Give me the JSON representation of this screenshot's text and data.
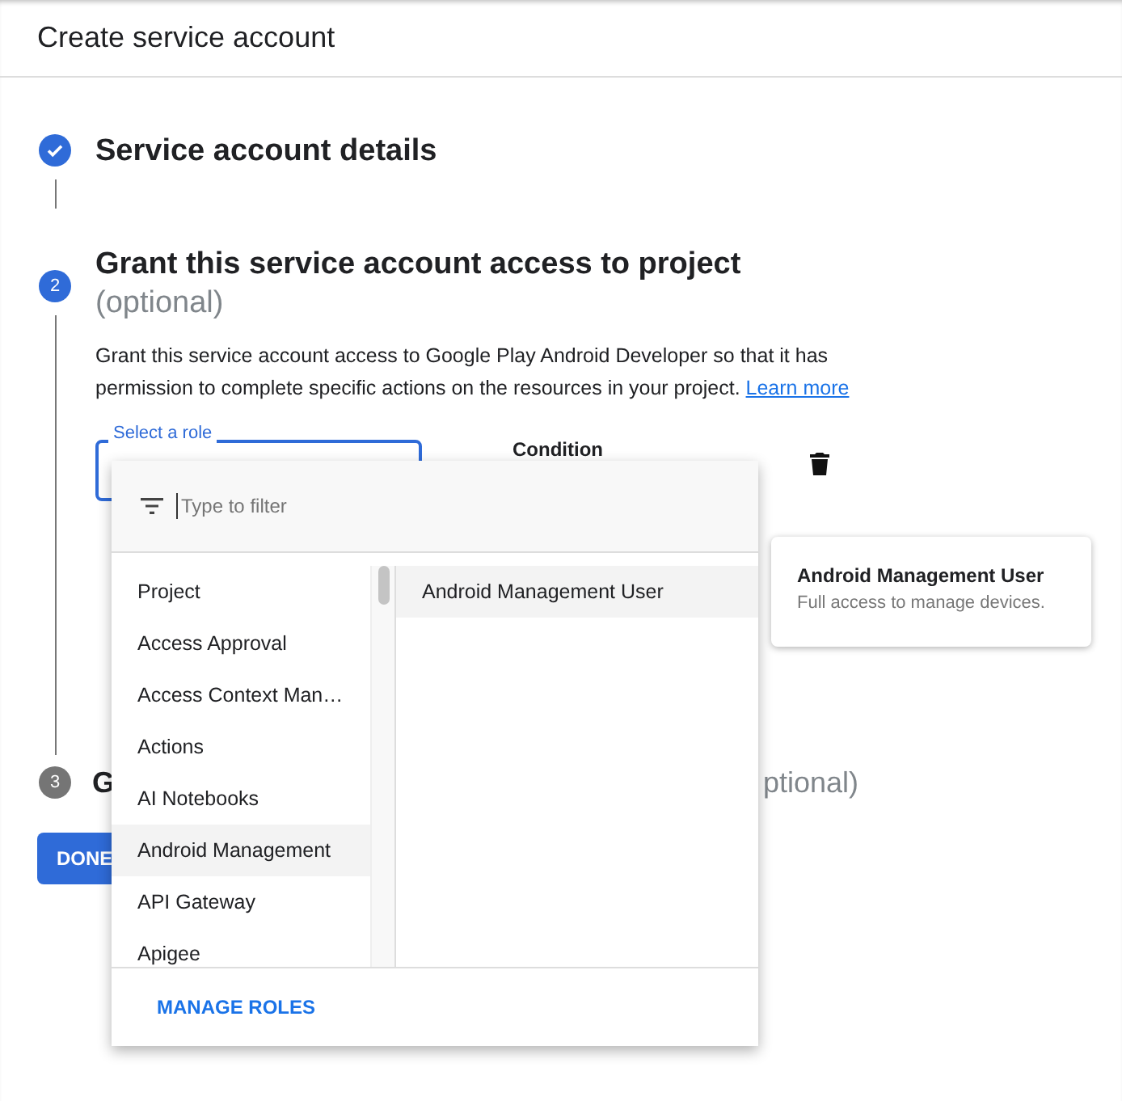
{
  "header": {
    "title": "Create service account"
  },
  "steps": [
    {
      "kind": "done",
      "title": "Service account details"
    },
    {
      "kind": "active",
      "number": "2",
      "title": "Grant this service account access to project",
      "subtitle": "(optional)",
      "description": "Grant this service account access to Google Play Android Developer so that it has permission to complete specific actions on the resources in your project.",
      "link": "Learn more",
      "role_label": "Select a role",
      "condition_label": "Condition"
    },
    {
      "kind": "pending",
      "number": "3",
      "title": "G",
      "subtitle": "ptional)"
    }
  ],
  "done_button": "DONE",
  "dropdown": {
    "filter": {
      "placeholder": "Type to filter"
    },
    "categories": [
      {
        "label": "Project",
        "selected": false
      },
      {
        "label": "Access Approval",
        "selected": false
      },
      {
        "label": "Access Context Man…",
        "selected": false
      },
      {
        "label": "Actions",
        "selected": false
      },
      {
        "label": "AI Notebooks",
        "selected": false
      },
      {
        "label": "Android Management",
        "selected": true
      },
      {
        "label": "API Gateway",
        "selected": false
      },
      {
        "label": "Apigee",
        "selected": false
      }
    ],
    "roles": [
      {
        "label": "Android Management User",
        "selected": true
      }
    ],
    "footer_button": "MANAGE ROLES"
  },
  "tooltip": {
    "title": "Android Management User",
    "description": "Full access to manage devices."
  }
}
